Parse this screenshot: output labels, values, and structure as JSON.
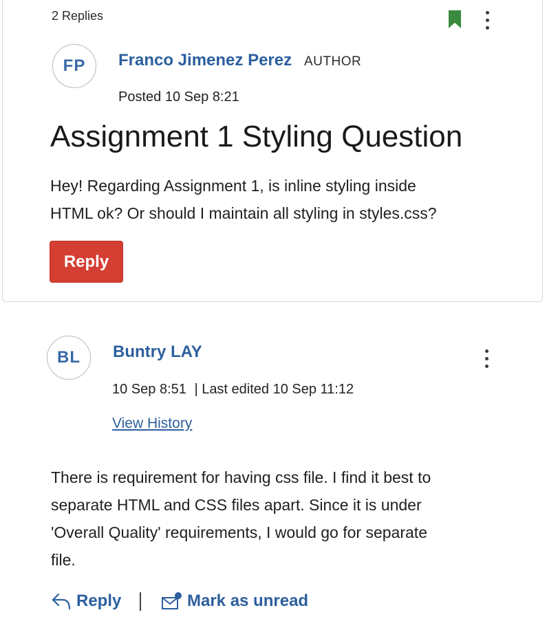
{
  "thread": {
    "replies_count": "2 Replies",
    "icons": {
      "bookmark": "bookmark-icon",
      "more": "more-options-icon"
    },
    "colors": {
      "bookmark": "#3a8a3f",
      "accent_blue": "#2c5f9e",
      "reply_button": "#d53f33"
    }
  },
  "post": {
    "avatar_initials": "FP",
    "author": "Franco Jimenez Perez",
    "role": "AUTHOR",
    "posted": "Posted 10 Sep 8:21",
    "title": "Assignment 1 Styling Question",
    "body_line1": "Hey! Regarding Assignment 1, is inline styling inside",
    "body_line2": "HTML ok? Or should I maintain all styling in styles.css?",
    "reply_label": "Reply"
  },
  "reply": {
    "avatar_initials": "BL",
    "author": "Buntry LAY",
    "date": "10 Sep 8:51",
    "edited": "| Last edited 10 Sep 11:12",
    "view_history": "View History",
    "body_line1": "There is requirement for having css file. I find it best to",
    "body_line2": "separate HTML and CSS files apart. Since it is under",
    "body_line3": "'Overall Quality' requirements, I would go for separate",
    "body_line4": "file.",
    "reply_label": "Reply",
    "mark_unread_label": "Mark as unread"
  }
}
